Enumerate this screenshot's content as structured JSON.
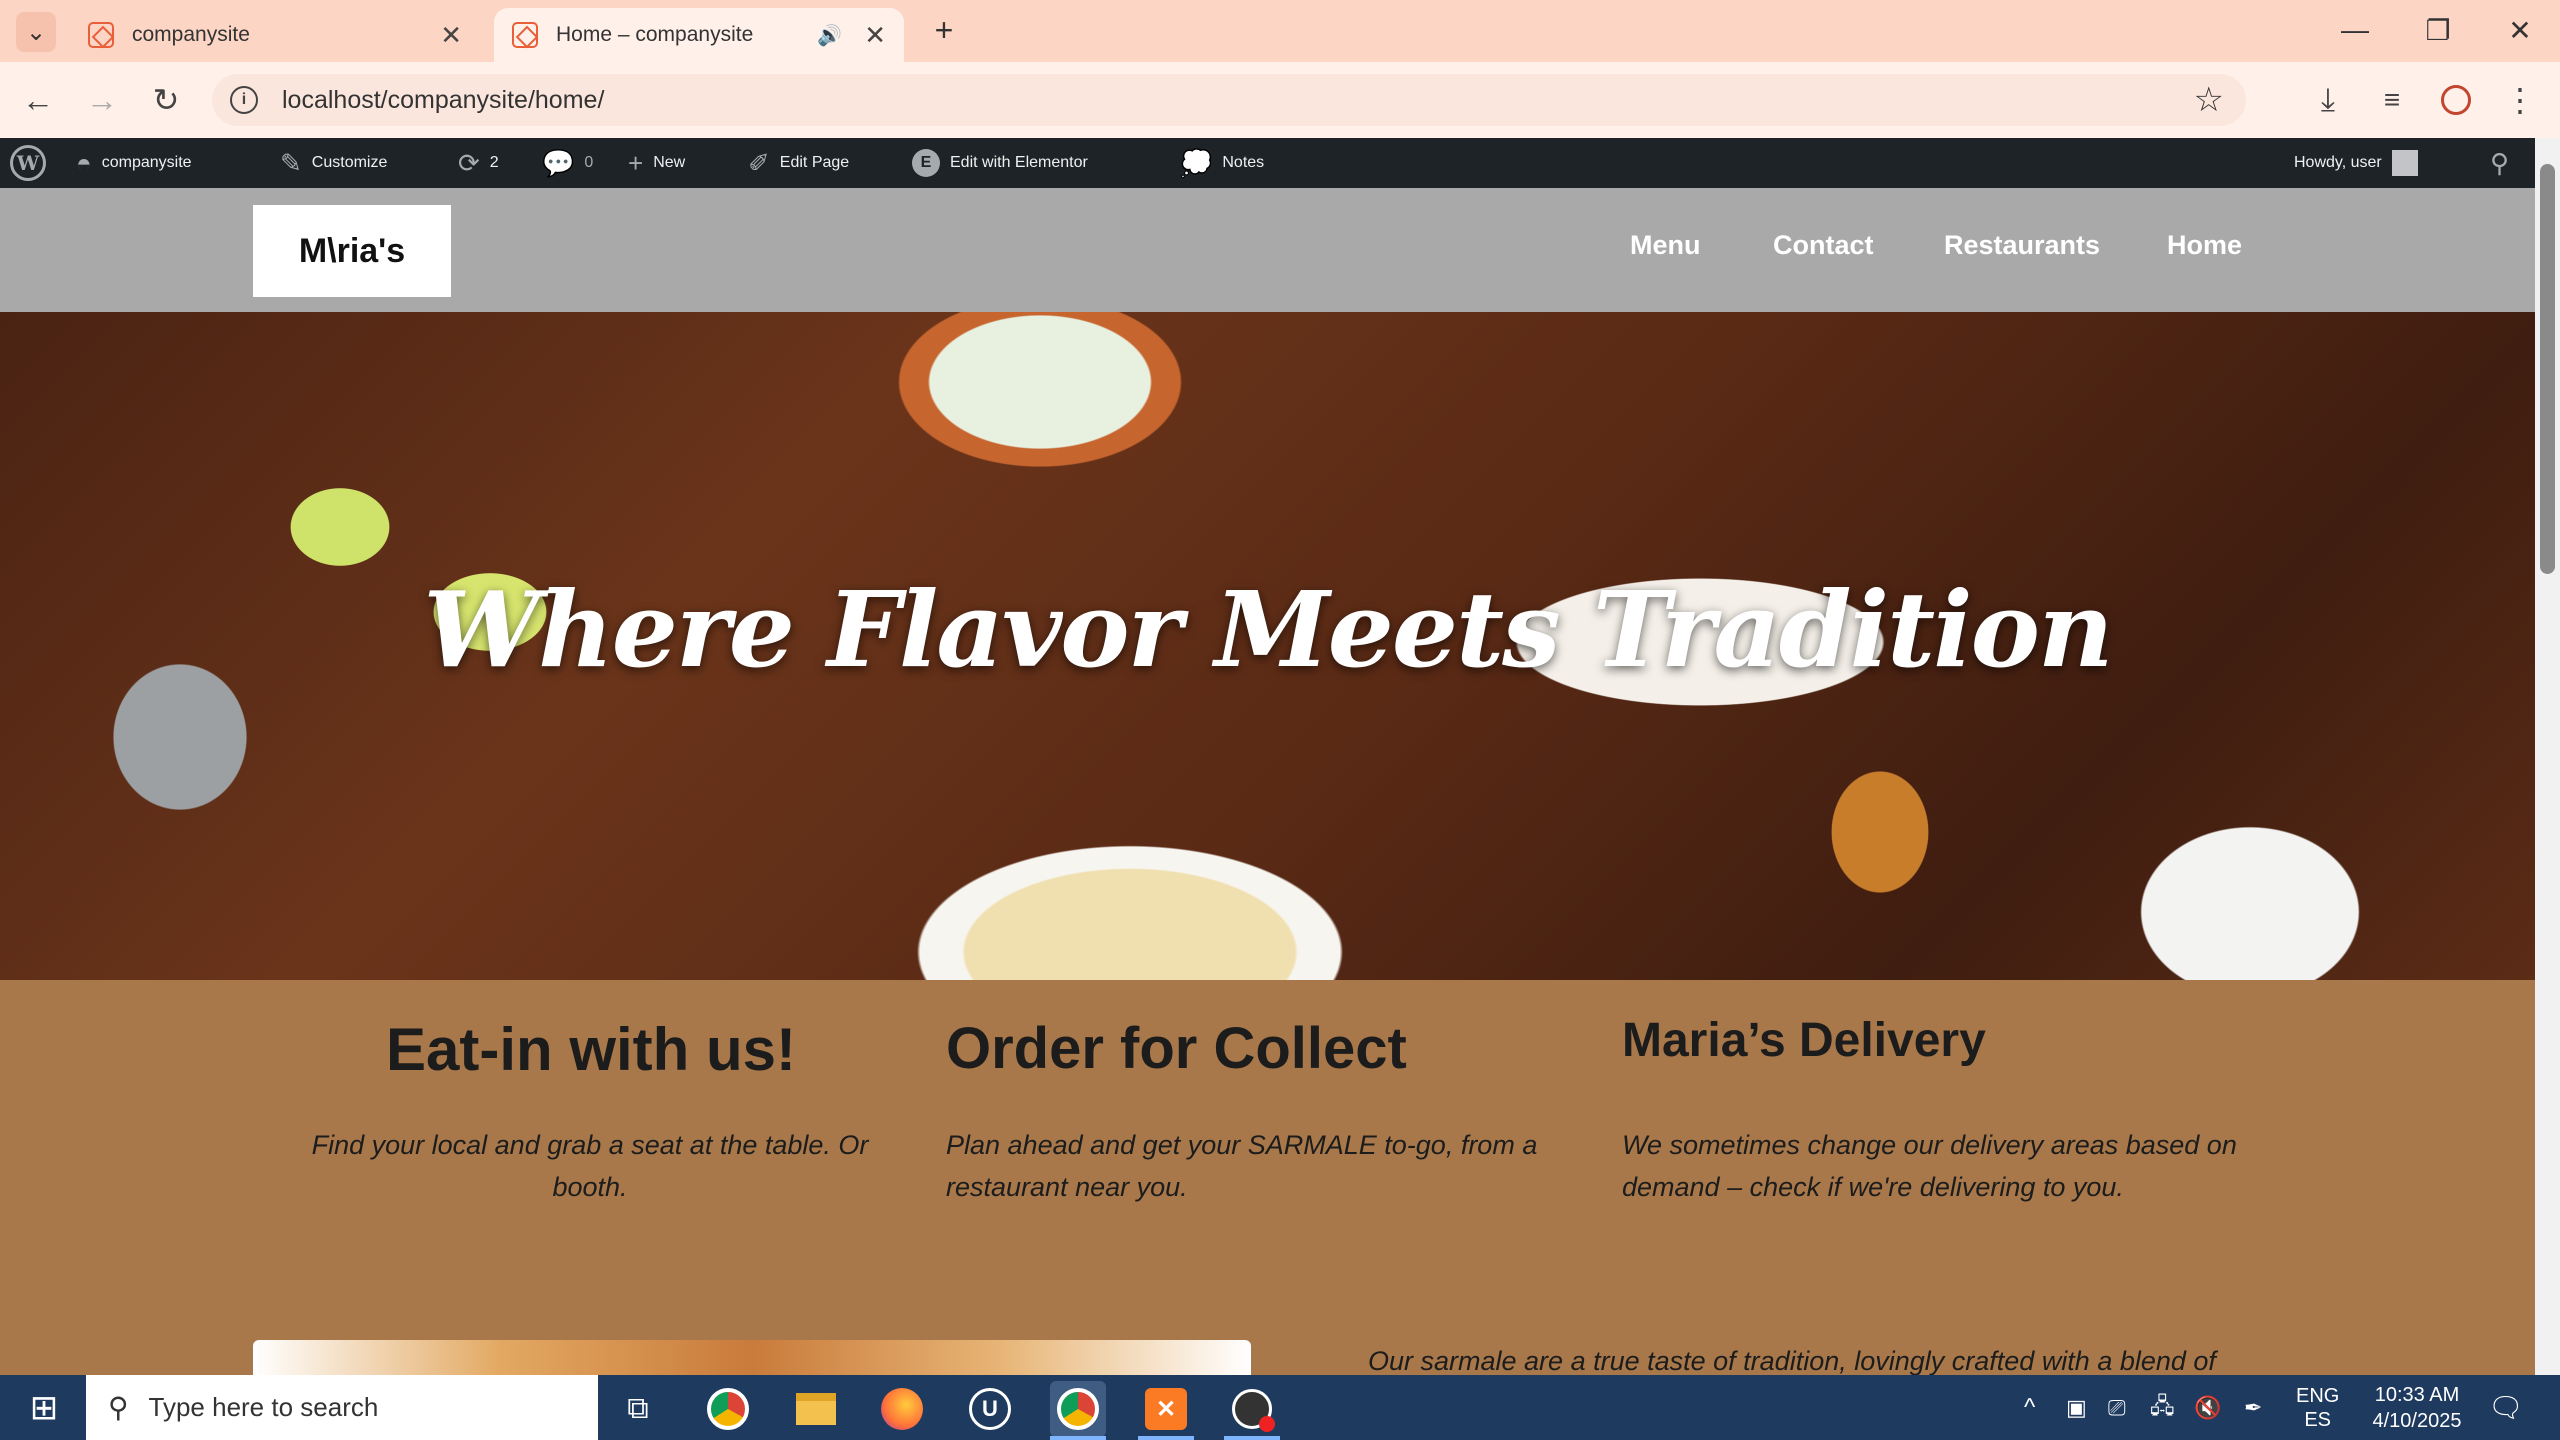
{
  "browser": {
    "tabs": [
      {
        "title": "companysite",
        "close": "✕"
      },
      {
        "title": "Home – companysite",
        "audio": "🔊",
        "close": "✕"
      }
    ],
    "new_tab": "+",
    "tab_list_icon": "⌄",
    "window": {
      "minimize": "—",
      "restore": "❐",
      "close": "✕"
    },
    "url": "localhost/companysite/home/"
  },
  "wp_admin_bar": {
    "site_name": "companysite",
    "customize": "Customize",
    "updates_count": "2",
    "comments_count": "0",
    "new": "New",
    "edit_page": "Edit Page",
    "edit_elementor": "Edit with Elementor",
    "notes": "Notes",
    "howdy": "Howdy, user"
  },
  "site": {
    "logo_text": "M\\ria's",
    "nav": [
      "Menu",
      "Contact",
      "Restaurants",
      "Home"
    ],
    "hero_title": "Where Flavor Meets Tradition",
    "columns": [
      {
        "heading": "Eat-in with us!",
        "text": "Find your local and grab a seat at the table. Or booth."
      },
      {
        "heading": "Order for Collect",
        "text": "Plan ahead and get your SARMALE to-go, from a restaurant near you."
      },
      {
        "heading": "Maria’s Delivery",
        "text": "We sometimes change our delivery areas based on demand – check if we're delivering to you."
      }
    ],
    "intro_text": "Our sarmale are a true taste of tradition, lovingly crafted with a blend of"
  },
  "taskbar": {
    "search_placeholder": "Type here to search",
    "lang_primary": "ENG",
    "lang_secondary": "ES",
    "time": "10:33 AM",
    "date": "4/10/2025"
  },
  "colors": {
    "tab_strip": "#fcd5c4",
    "wp_bar": "#1d2327",
    "site_header": "#a9a9a9",
    "content_bg": "#a8784a",
    "taskbar": "#1e3a5f"
  }
}
